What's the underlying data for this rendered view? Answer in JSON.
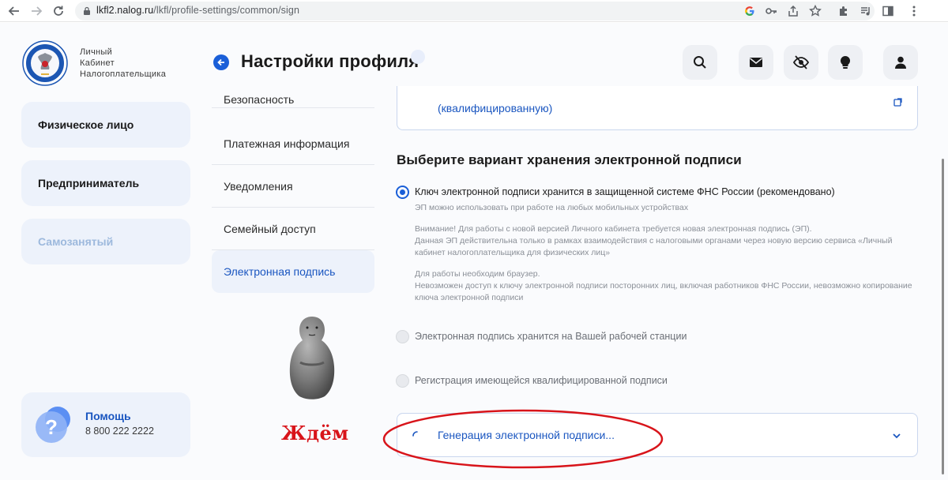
{
  "browser": {
    "url_domain": "lkfl2.nalog.ru",
    "url_path": "/lkfl/profile-settings/common/sign"
  },
  "brand": {
    "line1": "Личный",
    "line2": "Кабинет",
    "line3": "Налогоплательщика"
  },
  "sidebar": {
    "items": [
      {
        "label": "Физическое лицо"
      },
      {
        "label": "Предприниматель"
      },
      {
        "label": "Самозанятый"
      }
    ],
    "help": {
      "title": "Помощь",
      "phone": "8 800 222 2222"
    }
  },
  "header": {
    "title": "Настройки профиля"
  },
  "menu": {
    "items": [
      {
        "label": "Безопасность"
      },
      {
        "label": "Платежная информация"
      },
      {
        "label": "Уведомления"
      },
      {
        "label": "Семейный доступ"
      },
      {
        "label": "Электронная подпись"
      }
    ]
  },
  "mascot": {
    "caption": "Ждём"
  },
  "main": {
    "top_panel_text": "(квалифицированную)",
    "section_title": "Выберите вариант хранения электронной подписи",
    "options": [
      {
        "label": "Ключ электронной подписи хранится в защищенной системе ФНС России (рекомендовано)",
        "note1": "ЭП можно использовать при работе на любых мобильных устройствах",
        "note2a": "Внимание! Для работы с новой версией Личного кабинета требуется новая электронная подпись (ЭП).",
        "note2b": "Данная ЭП действительна только в рамках взаимодействия с налоговыми органами через новую версию сервиса «Личный кабинет налогоплательщика для физических лиц»",
        "note3a": "Для работы необходим браузер.",
        "note3b": "Невозможен доступ к ключу электронной подписи посторонних лиц, включая работников ФНС России, невозможно копирование ключа электронной подписи"
      },
      {
        "label": "Электронная подпись хранится на Вашей рабочей станции"
      },
      {
        "label": "Регистрация имеющейся квалифицированной подписи"
      }
    ],
    "generation_text": "Генерация электронной подписи..."
  },
  "colors": {
    "accent": "#1a5fd8",
    "link": "#1a56c0",
    "card_bg": "#edf2fb",
    "highlight": "#d8141a"
  }
}
